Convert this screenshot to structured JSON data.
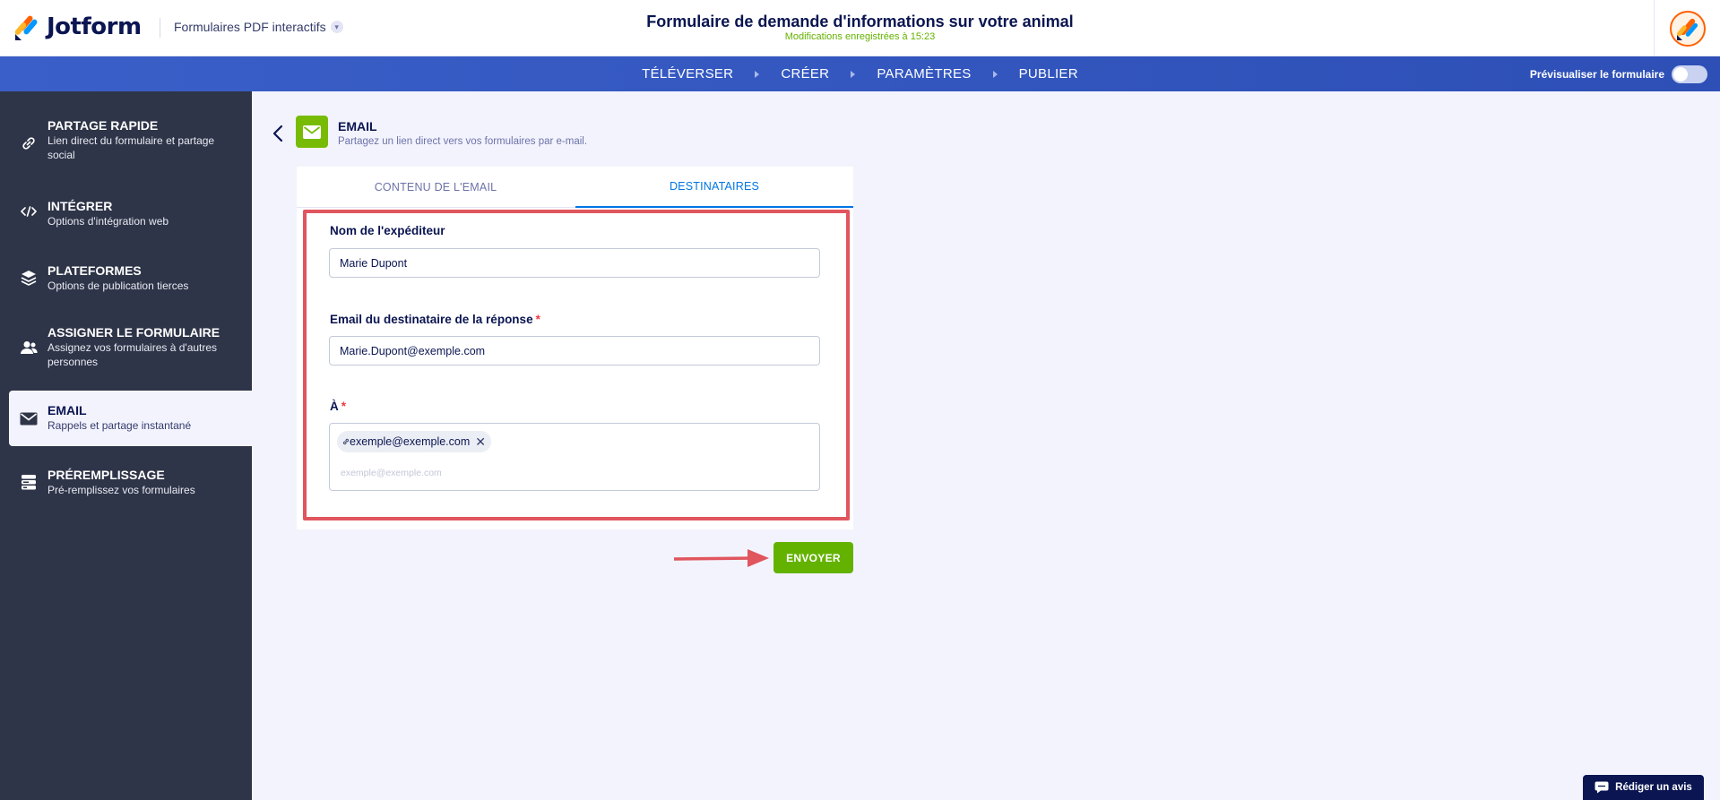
{
  "app": {
    "brand": "Jotform",
    "product_switch": "Formulaires PDF interactifs",
    "form_title": "Formulaire de demande d'informations sur votre animal",
    "save_status": "Modifications enregistrées à 15:23"
  },
  "nav": {
    "items": [
      "TÉLÉVERSER",
      "CRÉER",
      "PARAMÈTRES",
      "PUBLIER"
    ],
    "preview_label": "Prévisualiser le formulaire"
  },
  "sidebar": {
    "items": [
      {
        "title": "PARTAGE RAPIDE",
        "subtitle": "Lien direct du formulaire et partage social",
        "icon": "link-icon"
      },
      {
        "title": "INTÉGRER",
        "subtitle": "Options d'intégration web",
        "icon": "code-icon"
      },
      {
        "title": "PLATEFORMES",
        "subtitle": "Options de publication tierces",
        "icon": "layers-icon"
      },
      {
        "title": "ASSIGNER LE FORMULAIRE",
        "subtitle": "Assignez vos formulaires à d'autres personnes",
        "icon": "assign-users-icon"
      },
      {
        "title": "EMAIL",
        "subtitle": "Rappels et partage instantané",
        "icon": "envelope-icon",
        "active": true
      },
      {
        "title": "PRÉREMPLISSAGE",
        "subtitle": "Pré-remplissez vos formulaires",
        "icon": "prefill-icon"
      }
    ]
  },
  "section": {
    "title": "EMAIL",
    "subtitle": "Partagez un lien direct vers vos formulaires par e-mail."
  },
  "tabs": {
    "content": "CONTENU DE L'EMAIL",
    "recipients": "DESTINATAIRES",
    "active": "recipients"
  },
  "form": {
    "sender_label": "Nom de l'expéditeur",
    "sender_value": "Marie Dupont",
    "reply_label": "Email du destinataire de la réponse",
    "reply_value": "Marie.Dupont@exemple.com",
    "to_label": "À",
    "required_mark": "*",
    "to_chips": [
      "exemple@exemple.com"
    ],
    "to_placeholder": "exemple@exemple.com"
  },
  "actions": {
    "send": "ENVOYER",
    "review": "Rédiger un avis"
  },
  "colors": {
    "accent_blue": "#0075e3",
    "nav_blue": "#2f54bf",
    "sidebar_bg": "#2f3548",
    "send_green": "#64b200",
    "highlight_red": "#e0555e"
  }
}
